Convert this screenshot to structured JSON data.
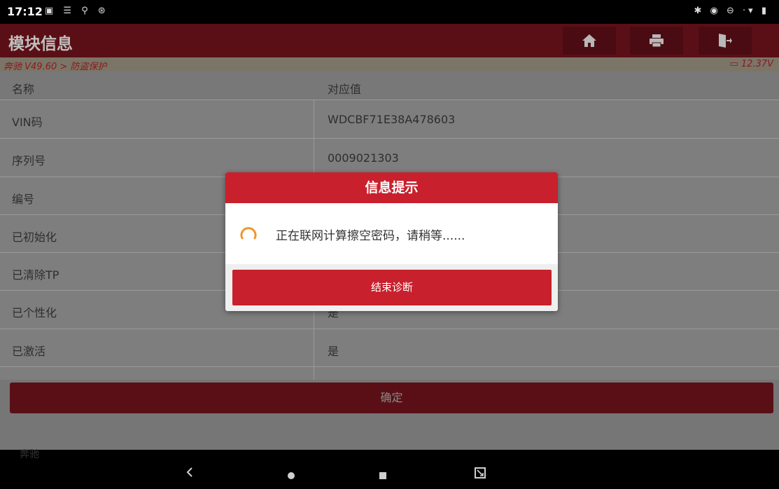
{
  "status_bar": {
    "time": "17:12",
    "left_icons": "▣ ☰ ⚲ ⊛",
    "right_icons": "✱ ◉ ⊖ ·▾ ▮"
  },
  "header": {
    "title": "模块信息",
    "buttons": [
      "home-icon",
      "print-icon",
      "exit-icon"
    ]
  },
  "breadcrumb": {
    "path": "奔驰 V49.60 > 防盗保护",
    "voltage": "12.37V"
  },
  "table": {
    "columns": [
      "名称",
      "对应值"
    ],
    "rows": [
      {
        "name": "VIN码",
        "value": "WDCBF71E38A478603"
      },
      {
        "name": "序列号",
        "value": "0009021303"
      },
      {
        "name": "编号",
        "value": ""
      },
      {
        "name": "已初始化",
        "value": ""
      },
      {
        "name": "已清除TP",
        "value": ""
      },
      {
        "name": "已个性化",
        "value": "是"
      },
      {
        "name": "已激活",
        "value": "是"
      }
    ]
  },
  "confirm": {
    "label": "确定"
  },
  "footer": {
    "label": "奔驰"
  },
  "nav": [
    "back-icon",
    "home-circle-icon",
    "recents-icon",
    "screenshot-icon"
  ],
  "dialog": {
    "title": "信息提示",
    "message": "正在联网计算擦空密码，请稍等......",
    "button": "结束诊断"
  },
  "colors": {
    "accent": "#c8202c",
    "title_bar": "#5a0f16",
    "spinner": "#f0962a"
  }
}
